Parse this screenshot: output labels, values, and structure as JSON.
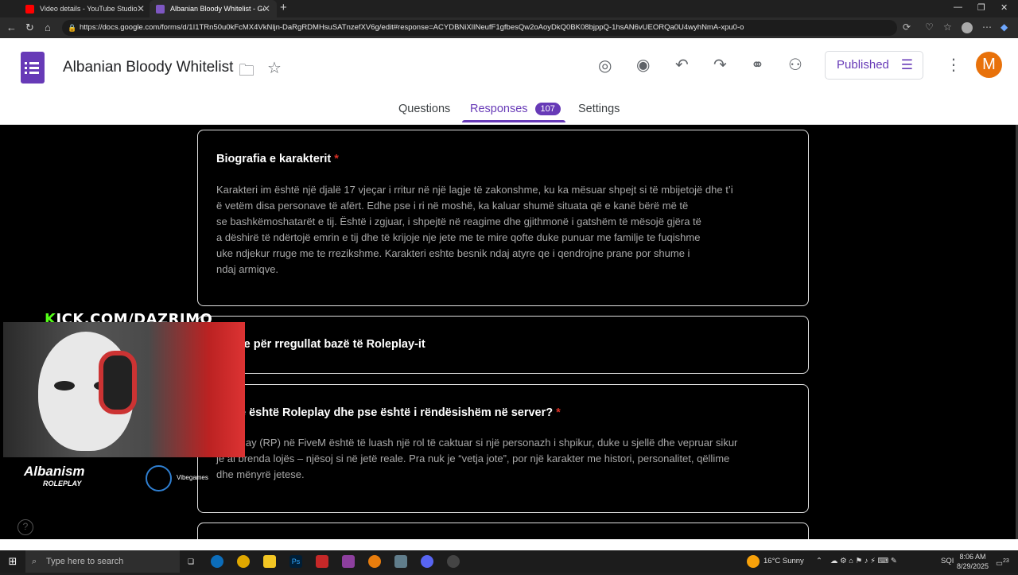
{
  "browser": {
    "tabs": [
      {
        "title": "Video details - YouTube Studio"
      },
      {
        "title": "Albanian Bloody Whitelist - Goog"
      }
    ],
    "url": "https://docs.google.com/forms/d/1I1TRn50u0kFcMX4VkNljn-DaRgRDMHsuSATnzefXV6g/edit#response=ACYDBNiXlINeufF1gfbesQw2oAoyDkQ0BK08bjppQ-1hsAN6vUEORQa0U4wyhNmA-xpu0-o"
  },
  "form": {
    "title": "Albanian Bloody Whitelist",
    "published_label": "Published",
    "avatar_letter": "M",
    "tabs": {
      "questions": "Questions",
      "responses": "Responses",
      "responses_count": "107",
      "settings": "Settings"
    }
  },
  "cards": [
    {
      "title": "Biografia e karakterit",
      "required": "*",
      "lines": [
        "Karakteri im është një djalë 17 vjeçar i rritur në një lagje të zakonshme, ku ka mësuar shpejt si të mbijetojë dhe t’i",
        "ë vetëm disa personave të afërt. Edhe pse i ri në moshë, ka kaluar shumë situata që e kanë bërë më të",
        "se bashkëmoshatarët e tij. Është i zgjuar, i shpejtë në reagime dhe gjithmonë i gatshëm të mësojë gjëra të",
        "a dëshirë të ndërtojë emrin e tij dhe të krijoje nje jete me te mire qofte duke punuar me familje te fuqishme",
        "uke ndjekur rruge me te rrezikshme. Karakteri eshte besnik ndaj atyre qe i qendrojne prane por shume i",
        "ndaj armiqve."
      ]
    },
    {
      "title": "Pyetje për rregullat bazë të Roleplay-it"
    },
    {
      "title": "Çfarë është Roleplay dhe pse është i rëndësishëm në server?",
      "required": "*",
      "lines": [
        "Roleplay (RP) në FiveM është të luash një rol të caktuar si një personazh i shpikur, duke u sjellë dhe vepruar sikur",
        "je ai brenda lojës – njësoj si në jetë reale. Pra nuk je “vetja jote”, por një karakter me histori, personalitet, qëllime",
        "dhe mënyrë jetese."
      ]
    }
  ],
  "overlay": {
    "kick_k": "K",
    "kick_rest": "ICK.COM/DAZRIMO",
    "logo_main": "Albanism",
    "logo_sub": "ROLEPLAY",
    "logo2": "Vibegames"
  },
  "taskbar": {
    "search_placeholder": "Type here to search",
    "weather": "16°C  Sunny",
    "lang": "SQI",
    "time": "8:06 AM",
    "date": "8/29/2025",
    "notif": "23"
  }
}
